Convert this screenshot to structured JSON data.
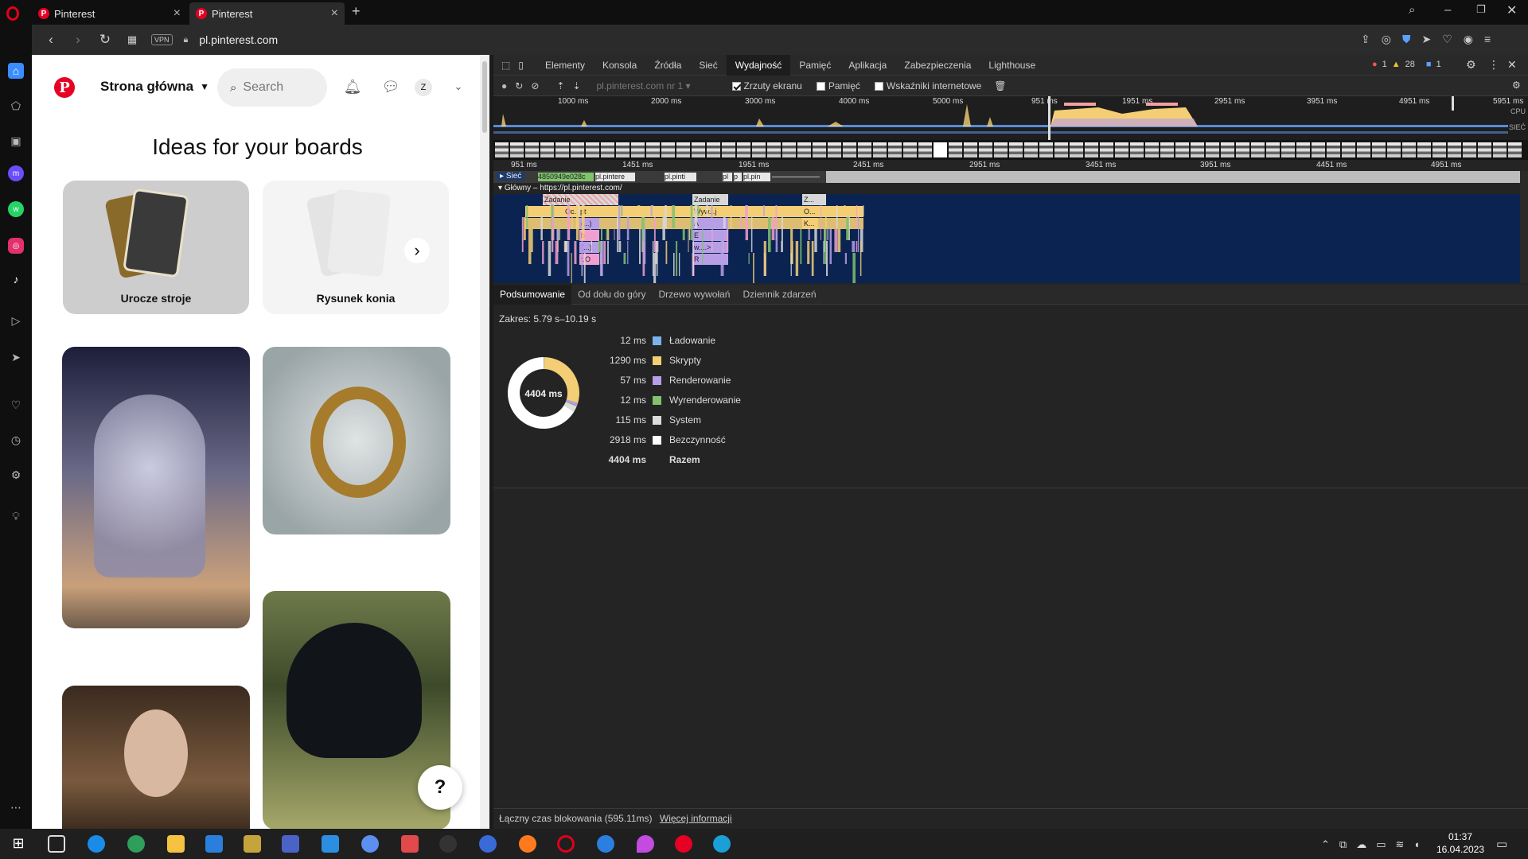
{
  "browser": {
    "tabs": [
      {
        "title": "Pinterest"
      },
      {
        "title": "Pinterest"
      }
    ],
    "url": "pl.pinterest.com",
    "vpn_label": "VPN"
  },
  "pinterest": {
    "home_label": "Strona główna",
    "search_placeholder": "Search",
    "avatar_letter": "Z",
    "ideas_title": "Ideas for your boards",
    "boards": [
      {
        "label": "Urocze stroje"
      },
      {
        "label": "Rysunek konia"
      }
    ],
    "help_label": "?"
  },
  "devtools": {
    "tabs": [
      "Elementy",
      "Konsola",
      "Źródła",
      "Sieć",
      "Wydajność",
      "Pamięć",
      "Aplikacja",
      "Zabezpieczenia",
      "Lighthouse"
    ],
    "active_tab": "Wydajność",
    "badges": {
      "errors": "1",
      "warnings": "28",
      "messages": "1"
    },
    "toolbar": {
      "profile_select": "pl.pinterest.com nr 1",
      "screenshots_label": "Zrzuty ekranu",
      "memory_label": "Pamięć",
      "web_vitals_label": "Wskaźniki internetowe"
    },
    "overview_ticks": [
      "1000 ms",
      "2000 ms",
      "3000 ms",
      "4000 ms",
      "5000 ms",
      "951 ms",
      "1951 ms",
      "2951 ms",
      "3951 ms",
      "4951 ms",
      "5951 ms"
    ],
    "overview_labels": {
      "cpu": "CPU",
      "net": "SIEĆ"
    },
    "ruler_ticks": [
      "951 ms",
      "1451 ms",
      "1951 ms",
      "2451 ms",
      "2951 ms",
      "3451 ms",
      "3951 ms",
      "4451 ms",
      "4951 ms"
    ],
    "network_track": {
      "label": "Sieć",
      "items": [
        "4850949e028c",
        "pl.pintere",
        "pl.pinti",
        "pl",
        "p",
        "pl.pin"
      ]
    },
    "main_track": "Główny – https://pl.pinterest.com/",
    "flame": {
      "zadanie": "Zadanie",
      "ocpt": "Oc...pt",
      "wywj": "Wyw...j",
      "dots": "(...)",
      "a": "A",
      "b": "b",
      "e": "E",
      "w": "w....>",
      "r": "R",
      "to": "t.O",
      "z": "Z...",
      "o": "O...",
      "k": "K..."
    },
    "bottom_tabs": [
      "Podsumowanie",
      "Od dołu do góry",
      "Drzewo wywołań",
      "Dziennik zdarzeń"
    ],
    "active_bottom_tab": "Podsumowanie",
    "summary": {
      "range": "Zakres: 5.79 s–10.19 s",
      "total_center": "4404 ms",
      "rows": [
        {
          "value": "12 ms",
          "label": "Ładowanie",
          "color": "#7cb1ef",
          "ms": 12
        },
        {
          "value": "1290 ms",
          "label": "Skrypty",
          "color": "#f4ce75",
          "ms": 1290
        },
        {
          "value": "57 ms",
          "label": "Renderowanie",
          "color": "#b69fe6",
          "ms": 57
        },
        {
          "value": "12 ms",
          "label": "Wyrenderowanie",
          "color": "#80c26d",
          "ms": 12
        },
        {
          "value": "115 ms",
          "label": "System",
          "color": "#dcdcdc",
          "ms": 115
        },
        {
          "value": "2918 ms",
          "label": "Bezczynność",
          "color": "#ffffff",
          "ms": 2918
        }
      ],
      "total_value": "4404 ms",
      "total_label": "Razem"
    },
    "status": {
      "text": "Łączny czas blokowania (595.11ms)",
      "link": "Więcej informacji"
    }
  },
  "taskbar": {
    "time": "01:37",
    "date": "16.04.2023"
  }
}
